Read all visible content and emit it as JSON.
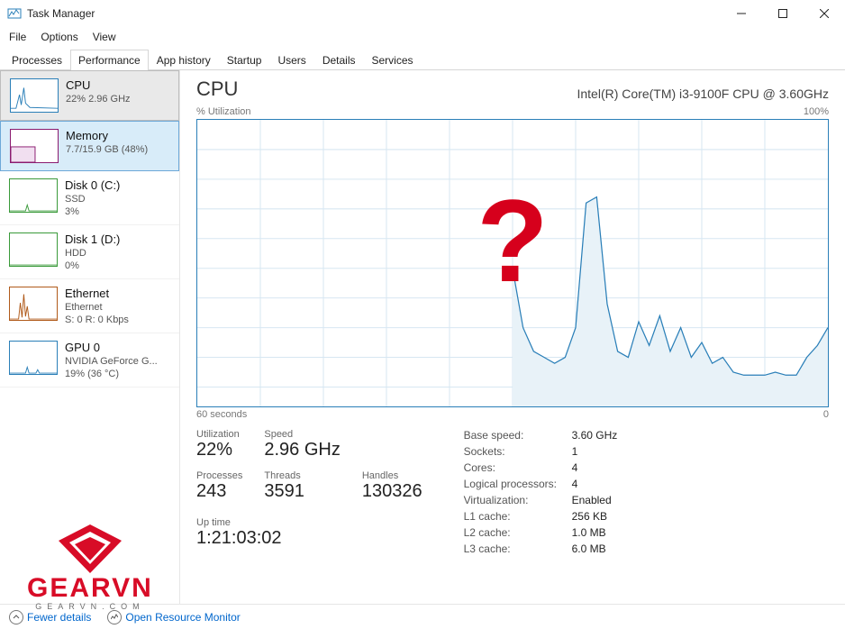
{
  "window": {
    "title": "Task Manager",
    "menu": [
      "File",
      "Options",
      "View"
    ],
    "tabs": [
      "Processes",
      "Performance",
      "App history",
      "Startup",
      "Users",
      "Details",
      "Services"
    ],
    "activeTab": 1
  },
  "sidebar": {
    "items": [
      {
        "title": "CPU",
        "sub": "22% 2.96 GHz",
        "color": "#2a7fb8",
        "state": "hover"
      },
      {
        "title": "Memory",
        "sub": "7.7/15.9 GB (48%)",
        "color": "#8a1a6f",
        "state": "selected"
      },
      {
        "title": "Disk 0 (C:)",
        "sub": "SSD",
        "sub2": "3%",
        "color": "#3a9a3a",
        "state": ""
      },
      {
        "title": "Disk 1 (D:)",
        "sub": "HDD",
        "sub2": "0%",
        "color": "#3a9a3a",
        "state": ""
      },
      {
        "title": "Ethernet",
        "sub": "Ethernet",
        "sub2": "S: 0 R: 0 Kbps",
        "color": "#b05a1a",
        "state": ""
      },
      {
        "title": "GPU 0",
        "sub": "NVIDIA GeForce G...",
        "sub2": "19% (36 °C)",
        "color": "#2a7fb8",
        "state": ""
      }
    ]
  },
  "main": {
    "heading": "CPU",
    "cpu_name": "Intel(R) Core(TM) i3-9100F CPU @ 3.60GHz",
    "chart_top_left": "% Utilization",
    "chart_top_right": "100%",
    "chart_btm_left": "60 seconds",
    "chart_btm_right": "0",
    "overlay_symbol": "?",
    "stats": {
      "utilization_label": "Utilization",
      "utilization": "22%",
      "speed_label": "Speed",
      "speed": "2.96 GHz",
      "processes_label": "Processes",
      "processes": "243",
      "threads_label": "Threads",
      "threads": "3591",
      "handles_label": "Handles",
      "handles": "130326",
      "uptime_label": "Up time",
      "uptime": "1:21:03:02"
    },
    "details": {
      "base_speed_label": "Base speed:",
      "base_speed": "3.60 GHz",
      "sockets_label": "Sockets:",
      "sockets": "1",
      "cores_label": "Cores:",
      "cores": "4",
      "lp_label": "Logical processors:",
      "lp": "4",
      "virt_label": "Virtualization:",
      "virt": "Enabled",
      "l1_label": "L1 cache:",
      "l1": "256 KB",
      "l2_label": "L2 cache:",
      "l2": "1.0 MB",
      "l3_label": "L3 cache:",
      "l3": "6.0 MB"
    }
  },
  "footer": {
    "fewer": "Fewer details",
    "orm": "Open Resource Monitor"
  },
  "watermark": {
    "brand": "GEARVN",
    "url": "GEARVN.COM"
  },
  "chart_data": {
    "type": "line",
    "title": "% Utilization",
    "xlabel": "seconds ago",
    "ylabel": "% Utilization",
    "xlim": [
      60,
      0
    ],
    "ylim": [
      0,
      100
    ],
    "note": "Left half of chart has no data (blank). Right half shows CPU utilization line with filled area below.",
    "series": [
      {
        "name": "CPU utilization",
        "x": [
          30,
          29,
          28,
          27,
          26,
          25,
          24,
          23,
          22,
          21,
          20,
          19,
          18,
          17,
          16,
          15,
          14,
          13,
          12,
          11,
          10,
          9,
          8,
          7,
          6,
          5,
          4,
          3,
          2,
          1,
          0
        ],
        "values": [
          50,
          30,
          22,
          20,
          18,
          20,
          30,
          72,
          74,
          38,
          22,
          20,
          32,
          24,
          34,
          22,
          30,
          20,
          25,
          18,
          20,
          15,
          14,
          14,
          14,
          15,
          14,
          14,
          20,
          24,
          30
        ]
      }
    ]
  }
}
